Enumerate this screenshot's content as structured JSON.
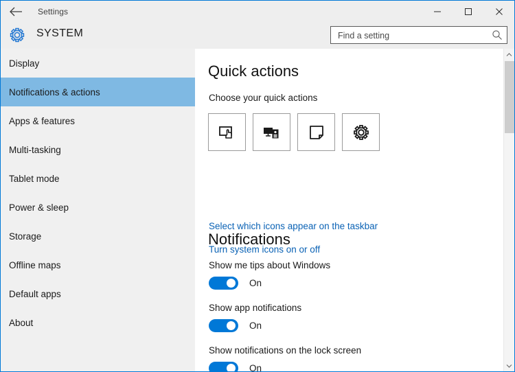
{
  "titlebar": {
    "back_label": "back-arrow",
    "title": "Settings",
    "minimize": "minimize",
    "maximize": "maximize",
    "close": "close"
  },
  "header": {
    "icon": "gear-icon",
    "title": "SYSTEM"
  },
  "search": {
    "placeholder": "Find a setting",
    "value": "",
    "icon": "search-icon"
  },
  "sidebar": {
    "items": [
      {
        "label": "Display",
        "active": false
      },
      {
        "label": "Notifications & actions",
        "active": true
      },
      {
        "label": "Apps & features",
        "active": false
      },
      {
        "label": "Multi-tasking",
        "active": false
      },
      {
        "label": "Tablet mode",
        "active": false
      },
      {
        "label": "Power & sleep",
        "active": false
      },
      {
        "label": "Storage",
        "active": false
      },
      {
        "label": "Offline maps",
        "active": false
      },
      {
        "label": "Default apps",
        "active": false
      },
      {
        "label": "About",
        "active": false
      }
    ],
    "active_color": "#7fb9e3"
  },
  "content": {
    "quick_actions": {
      "heading": "Quick actions",
      "subtitle": "Choose your quick actions",
      "tiles": [
        {
          "icon": "tablet-mode-icon",
          "name": "tablet-mode"
        },
        {
          "icon": "connect-display-icon",
          "name": "connect"
        },
        {
          "icon": "note-icon",
          "name": "note"
        },
        {
          "icon": "settings-gear-icon",
          "name": "all-settings"
        }
      ],
      "links": [
        {
          "text": "Select which icons appear on the taskbar"
        },
        {
          "text": "Turn system icons on or off"
        }
      ],
      "link_color": "#0a62b5"
    },
    "notifications": {
      "heading": "Notifications",
      "settings": [
        {
          "label": "Show me tips about Windows",
          "state": "On",
          "on": true
        },
        {
          "label": "Show app notifications",
          "state": "On",
          "on": true
        },
        {
          "label": "Show notifications on the lock screen",
          "state": "On",
          "on": true
        }
      ],
      "toggle_on_color": "#0078d7"
    }
  },
  "scrollbar": {
    "up_arrow": "chevron-up-icon",
    "down_arrow": "chevron-down-icon"
  },
  "theme": {
    "window_border": "#0078d7",
    "chrome_bg": "#eeeeee",
    "sidebar_bg": "#f0f0f0"
  }
}
